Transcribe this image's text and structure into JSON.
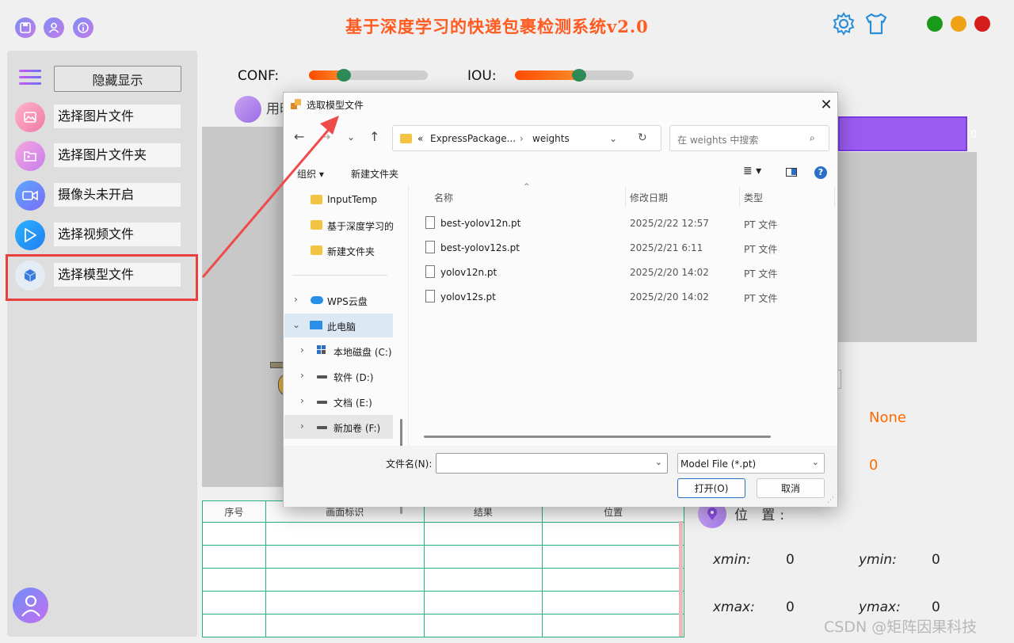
{
  "app": {
    "title": "基于深度学习的快递包裹检测系统v2.0",
    "window_controls": [
      "#1a9a1a",
      "#f0a216",
      "#d61d1d"
    ],
    "accent": "#ff5a1f"
  },
  "sidebar": {
    "hide_button": "隐藏显示",
    "items": [
      {
        "label": "选择图片文件",
        "icon": "image-file-icon"
      },
      {
        "label": "选择图片文件夹",
        "icon": "image-folder-icon"
      },
      {
        "label": "摄像头未开启",
        "icon": "camera-icon"
      },
      {
        "label": "选择视频文件",
        "icon": "video-play-icon"
      },
      {
        "label": "选择模型文件",
        "icon": "model-cube-icon"
      }
    ]
  },
  "controls": {
    "conf_label": "CONF:",
    "conf_value": 0.29,
    "iou_label": "IOU:",
    "iou_value": 0.54,
    "use_text": "用时"
  },
  "results": {
    "class_value": "None",
    "count_value": "0",
    "position_label": "位 置:",
    "progress_value": "0",
    "xmin_label": "xmin:",
    "xmin": "0",
    "ymin_label": "ymin:",
    "ymin": "0",
    "xmax_label": "xmax:",
    "xmax": "0",
    "ymax_label": "ymax:",
    "ymax": "0"
  },
  "table": {
    "columns": [
      "序号",
      "画面标识",
      "结果",
      "位置"
    ]
  },
  "dialog": {
    "title": "选取模型文件",
    "breadcrumb_prefix": "«",
    "breadcrumb": [
      "ExpressPackage...",
      "weights"
    ],
    "search_placeholder": "在 weights 中搜索",
    "toolbar_organize": "组织 ▾",
    "toolbar_new_folder": "新建文件夹",
    "nav_tree": [
      {
        "label": "InputTemp",
        "type": "folder"
      },
      {
        "label": "基于深度学习的",
        "type": "folder"
      },
      {
        "label": "新建文件夹",
        "type": "folder"
      },
      {
        "label": "WPS云盘",
        "type": "cloud"
      },
      {
        "label": "此电脑",
        "type": "pc"
      },
      {
        "label": "本地磁盘 (C:)",
        "type": "drive"
      },
      {
        "label": "软件 (D:)",
        "type": "drive"
      },
      {
        "label": "文档 (E:)",
        "type": "drive"
      },
      {
        "label": "新加卷 (F:)",
        "type": "drive"
      }
    ],
    "columns": {
      "name": "名称",
      "modified": "修改日期",
      "type": "类型"
    },
    "files": [
      {
        "name": "best-yolov12n.pt",
        "modified": "2025/2/22 12:57",
        "type": "PT 文件"
      },
      {
        "name": "best-yolov12s.pt",
        "modified": "2025/2/21 6:11",
        "type": "PT 文件"
      },
      {
        "name": "yolov12n.pt",
        "modified": "2025/2/20 14:02",
        "type": "PT 文件"
      },
      {
        "name": "yolov12s.pt",
        "modified": "2025/2/20 14:02",
        "type": "PT 文件"
      }
    ],
    "filename_label": "文件名(N):",
    "filename_value": "",
    "filter_value": "Model File (*.pt)",
    "open_button": "打开(O)",
    "cancel_button": "取消"
  },
  "watermark": "CSDN @矩阵因果科技"
}
